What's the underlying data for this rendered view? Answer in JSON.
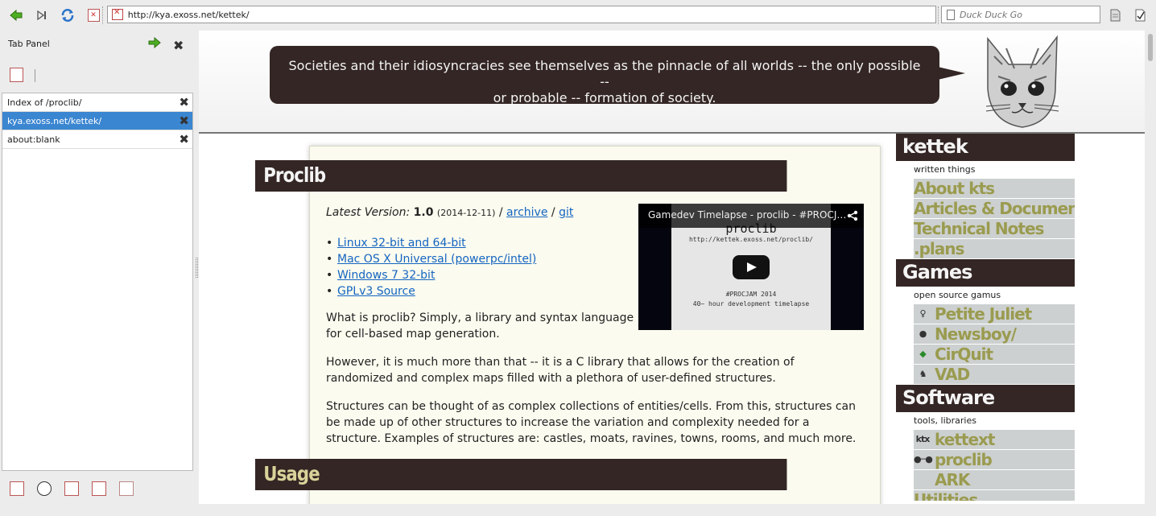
{
  "toolbar": {
    "url": "http://kya.exoss.net/kettek/",
    "search_placeholder": "Duck Duck Go"
  },
  "panel": {
    "title": "Tab Panel",
    "tabs": [
      {
        "label": "Index of /proclib/"
      },
      {
        "label": "kya.exoss.net/kettek/"
      },
      {
        "label": "about:blank"
      }
    ]
  },
  "header": {
    "quote_line1": "Societies and their idiosyncracies see themselves as the pinnacle of all worlds -- the only possible --",
    "quote_line2": "or probable -- formation of society."
  },
  "main": {
    "title": "Proclib",
    "version_label": "Latest Version:",
    "version_number": "1.0",
    "version_date": "(2014-12-11)",
    "sep1": "/",
    "archive_link": "archive",
    "sep2": "/",
    "git_link": "git",
    "downloads": [
      "Linux 32-bit and 64-bit",
      "Mac OS X Universal (powerpc/intel)",
      "Windows 7 32-bit",
      "GPLv3 Source"
    ],
    "para1": "What is proclib? Simply, a library and syntax language for cell-based map generation.",
    "para2": "However, it is much more than that -- it is a C library that allows for the creation of randomized and complex maps filled with a plethora of user-defined structures.",
    "para3": "Structures can be thought of as complex collections of entities/cells. From this, structures can be made up of other structures to increase the variation and complexity needed for a structure. Examples of structures are: castles, moats, ravines, towns, rooms, and much more.",
    "usage_title": "Usage",
    "video": {
      "title": "Gamedev Timelapse - proclib - #PROCJ…",
      "shot_title": "proclib",
      "shot_url": "http://kettek.exoss.net/proclib/",
      "shot_line1": "#PROCJAM 2014",
      "shot_line2": "40~ hour development timelapse"
    }
  },
  "sidebar": {
    "sections": [
      {
        "title": "kettek",
        "subtitle": "written things",
        "items": [
          {
            "label": "About kts",
            "icon": ""
          },
          {
            "label": "Articles & Documents",
            "icon": ""
          },
          {
            "label": "Technical Notes",
            "icon": ""
          },
          {
            "label": ".plans",
            "icon": ""
          }
        ]
      },
      {
        "title": "Games",
        "subtitle": "open source gamus",
        "items": [
          {
            "label": "Petite Juliet",
            "icon": "figure-icon"
          },
          {
            "label": "Newsboy/",
            "icon": "ball-icon"
          },
          {
            "label": "CirQuit",
            "icon": "gem-icon"
          },
          {
            "label": "VAD",
            "icon": "creature-icon"
          }
        ]
      },
      {
        "title": "Software",
        "subtitle": "tools, libraries",
        "items": [
          {
            "label": "kettext",
            "icon": "ktx-icon"
          },
          {
            "label": "proclib",
            "icon": "nodes-icon"
          },
          {
            "label": "ARK",
            "icon": "blank-icon"
          }
        ]
      }
    ],
    "partial_title": "Utilities"
  },
  "colors": {
    "dark_band": "#332624",
    "link": "#1565c0",
    "sidebar_item_text": "#9a9b4f",
    "selected_tab": "#3b86d1"
  }
}
